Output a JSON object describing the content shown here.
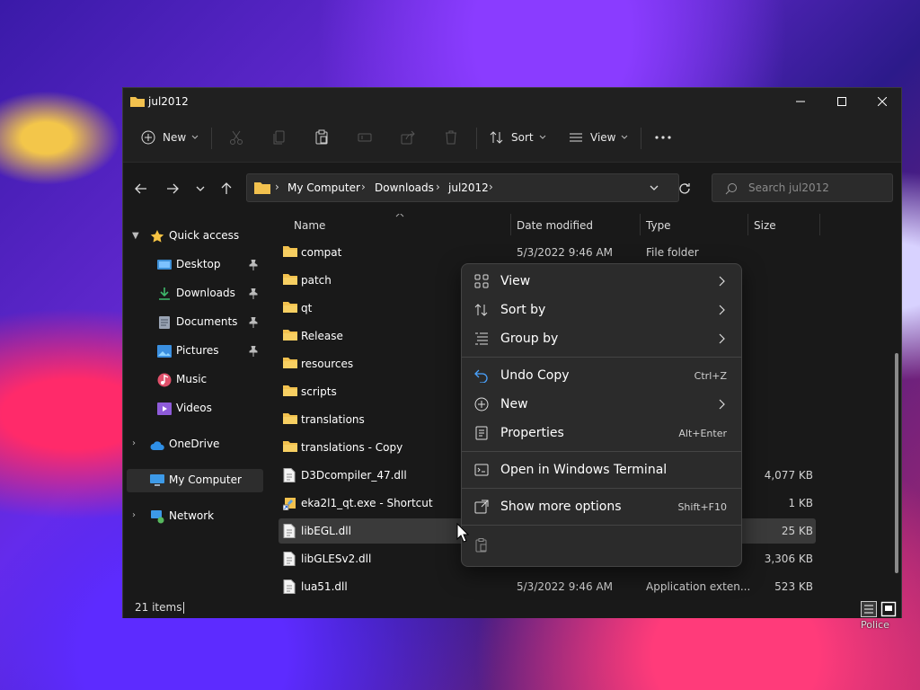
{
  "window": {
    "title": "jul2012"
  },
  "toolbar": {
    "new_label": "New",
    "sort_label": "Sort",
    "view_label": "View"
  },
  "address": {
    "crumbs": [
      "My Computer",
      "Downloads",
      "jul2012"
    ]
  },
  "search": {
    "placeholder": "Search jul2012"
  },
  "sidebar": {
    "quick_access": "Quick access",
    "items": [
      {
        "label": "Desktop",
        "icon": "desktop-icon",
        "pinned": true
      },
      {
        "label": "Downloads",
        "icon": "downloads-icon",
        "pinned": true
      },
      {
        "label": "Documents",
        "icon": "documents-icon",
        "pinned": true
      },
      {
        "label": "Pictures",
        "icon": "pictures-icon",
        "pinned": true
      },
      {
        "label": "Music",
        "icon": "music-icon",
        "pinned": false
      },
      {
        "label": "Videos",
        "icon": "videos-icon",
        "pinned": false
      }
    ],
    "onedrive": "OneDrive",
    "my_computer": "My Computer",
    "network": "Network"
  },
  "columns": {
    "name": "Name",
    "date": "Date modified",
    "type": "Type",
    "size": "Size"
  },
  "files": [
    {
      "name": "compat",
      "kind": "folder",
      "date": "5/3/2022 9:46 AM",
      "type": "File folder",
      "size": ""
    },
    {
      "name": "patch",
      "kind": "folder",
      "date": "",
      "type": "",
      "size": ""
    },
    {
      "name": "qt",
      "kind": "folder",
      "date": "",
      "type": "",
      "size": ""
    },
    {
      "name": "Release",
      "kind": "folder",
      "date": "",
      "type": "",
      "size": ""
    },
    {
      "name": "resources",
      "kind": "folder",
      "date": "",
      "type": "",
      "size": ""
    },
    {
      "name": "scripts",
      "kind": "folder",
      "date": "",
      "type": "",
      "size": ""
    },
    {
      "name": "translations",
      "kind": "folder",
      "date": "",
      "type": "",
      "size": ""
    },
    {
      "name": "translations - Copy",
      "kind": "folder",
      "date": "",
      "type": "",
      "size": ""
    },
    {
      "name": "D3Dcompiler_47.dll",
      "kind": "dll",
      "date": "",
      "type": "",
      "size": "4,077 KB"
    },
    {
      "name": "eka2l1_qt.exe - Shortcut",
      "kind": "shortcut",
      "date": "",
      "type": "",
      "size": "1 KB"
    },
    {
      "name": "libEGL.dll",
      "kind": "dll",
      "date": "",
      "type": "",
      "size": "25 KB",
      "selected": true
    },
    {
      "name": "libGLESv2.dll",
      "kind": "dll",
      "date": "",
      "type": "",
      "size": "3,306 KB"
    },
    {
      "name": "lua51.dll",
      "kind": "dll",
      "date": "5/3/2022 9:46 AM",
      "type": "Application exten...",
      "size": "523 KB"
    }
  ],
  "status": {
    "count": "21 items"
  },
  "context_menu": {
    "view": "View",
    "sort_by": "Sort by",
    "group_by": "Group by",
    "undo_copy": "Undo Copy",
    "undo_copy_key": "Ctrl+Z",
    "new": "New",
    "properties": "Properties",
    "properties_key": "Alt+Enter",
    "open_terminal": "Open in Windows Terminal",
    "show_more": "Show more options",
    "show_more_key": "Shift+F10"
  },
  "desktop": {
    "police_label": "Police"
  },
  "colors": {
    "folder": "#f2c14e",
    "accent": "#4aa3ff",
    "window_bg": "#191919",
    "menu_bg": "#2b2b2b"
  }
}
